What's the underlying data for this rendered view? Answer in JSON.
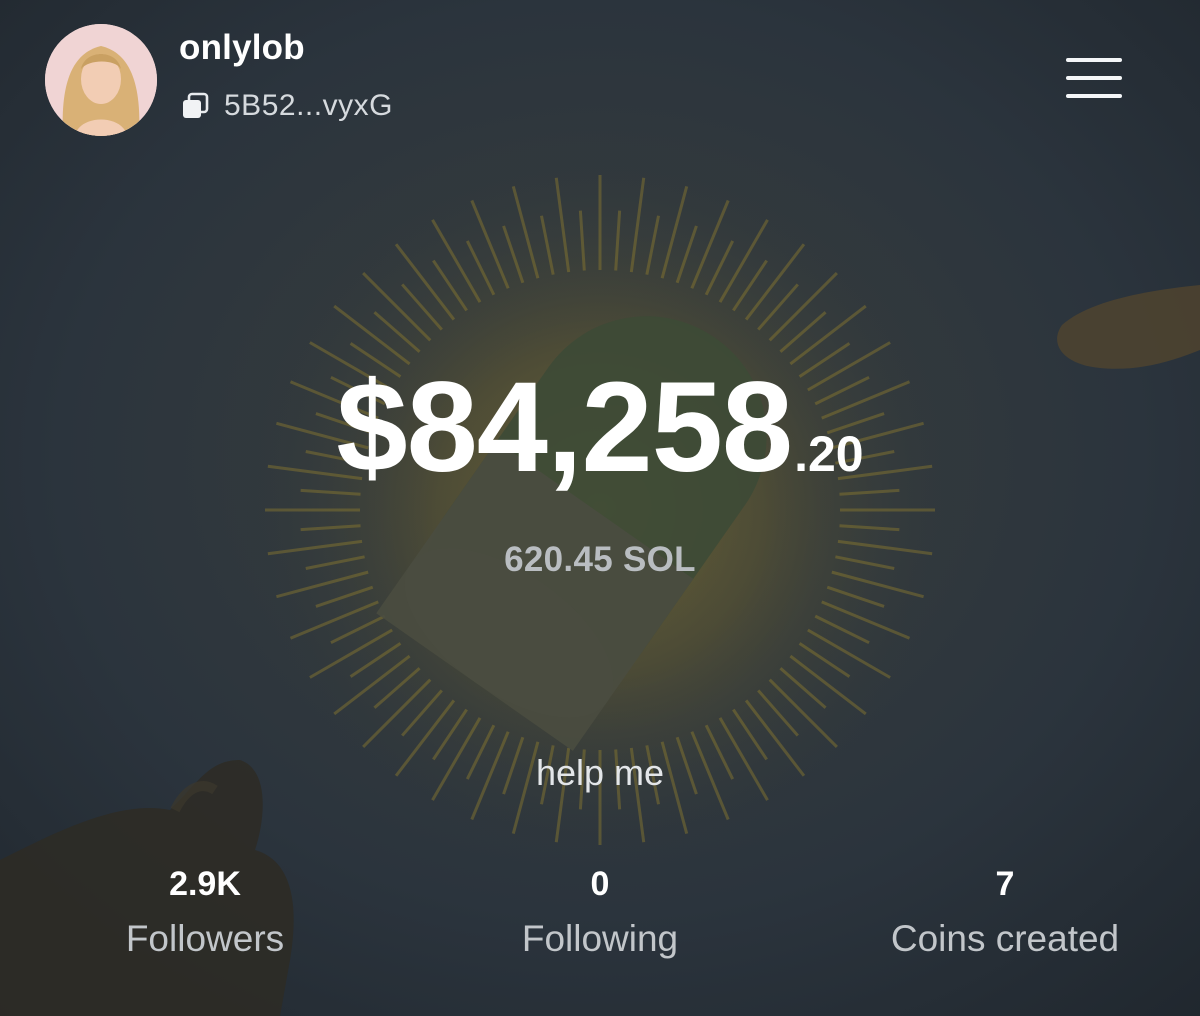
{
  "profile": {
    "username": "onlylob",
    "address": "5B52...vyxG"
  },
  "balance": {
    "main": "$84,258",
    "cents": ".20",
    "sol": "620.45 SOL"
  },
  "bio": "help me",
  "stats": [
    {
      "value": "2.9K",
      "label": "Followers"
    },
    {
      "value": "0",
      "label": "Following"
    },
    {
      "value": "7",
      "label": "Coins created"
    }
  ],
  "icons": {
    "copy": "copy-icon",
    "menu": "hamburger-menu-icon"
  },
  "colors": {
    "background": "#2a333c",
    "text_primary": "#ffffff",
    "text_secondary": "#b9bdc1",
    "pill_green": "#3f4d36",
    "sun_glow": "#8a7a2c"
  }
}
